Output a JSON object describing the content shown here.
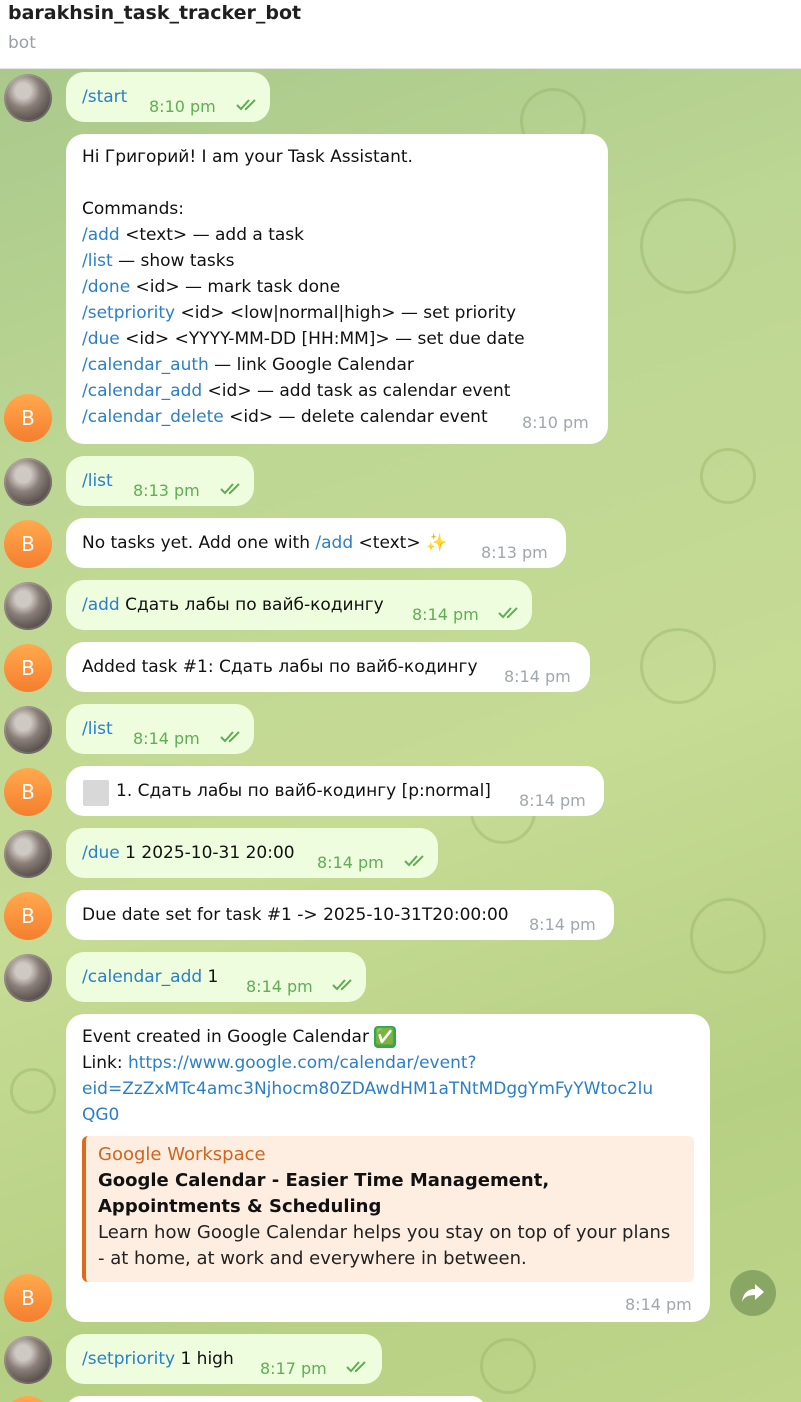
{
  "header": {
    "title": "barakhsin_task_tracker_bot",
    "subtitle": "bot"
  },
  "bot_avatar_letter": "B",
  "messages": [
    {
      "from": "user",
      "command": "/start",
      "text": "",
      "time": "8:10 pm"
    },
    {
      "from": "bot",
      "greeting": "Hi Григорий! I am your Task Assistant.",
      "commands_title": "Commands:",
      "commands": [
        {
          "cmd": "/add",
          "rest": " <text> — add a task"
        },
        {
          "cmd": "/list",
          "rest": " — show tasks"
        },
        {
          "cmd": "/done",
          "rest": " <id> — mark task done"
        },
        {
          "cmd": "/setpriority",
          "rest": " <id> <low|normal|high> — set priority"
        },
        {
          "cmd": "/due",
          "rest": " <id> <YYYY-MM-DD [HH:MM]> — set due date"
        },
        {
          "cmd": "/calendar_auth",
          "rest": " — link Google Calendar"
        },
        {
          "cmd": "/calendar_add",
          "rest": " <id> — add task as calendar event"
        },
        {
          "cmd": "/calendar_delete",
          "rest": " <id> — delete calendar event"
        }
      ],
      "time": "8:10 pm"
    },
    {
      "from": "user",
      "command": "/list",
      "text": "",
      "time": "8:13 pm"
    },
    {
      "from": "bot",
      "prefix": "No tasks yet. Add one with ",
      "cmd": "/add",
      "suffix": " <text> ",
      "emoji": "✨",
      "time": "8:13 pm"
    },
    {
      "from": "user",
      "command": "/add",
      "text": " Сдать лабы по вайб-кодингу",
      "time": "8:14 pm"
    },
    {
      "from": "bot",
      "text": "Added task #1: Сдать лабы по вайб-кодингу",
      "time": "8:14 pm"
    },
    {
      "from": "user",
      "command": "/list",
      "text": "",
      "time": "8:14 pm"
    },
    {
      "from": "bot",
      "text": "1. Сдать лабы по вайб-кодингу [p:normal]",
      "time": "8:14 pm"
    },
    {
      "from": "user",
      "command": "/due",
      "text": " 1 2025-10-31 20:00",
      "time": "8:14 pm"
    },
    {
      "from": "bot",
      "text": "Due date set for task #1 -> 2025-10-31T20:00:00",
      "time": "8:14 pm"
    },
    {
      "from": "user",
      "command": "/calendar_add",
      "text": " 1",
      "time": "8:14 pm"
    },
    {
      "from": "bot",
      "text": "Event created in Google Calendar ",
      "emoji": "✅",
      "link_label": "Link: ",
      "link_line1": "https://www.google.com/calendar/event?",
      "link_line2": "eid=ZzZxMTc4amc3Njhocm80ZDAwdHM1aTNtMDggYmFyYWtoc2lu",
      "link_line3": "QG0",
      "preview_site": "Google Workspace",
      "preview_title": "Google Calendar - Easier Time Management, Appointments & Scheduling",
      "preview_desc": "Learn how Google Calendar helps you stay on top of your plans - at home, at work and everywhere in between.",
      "time": "8:14 pm"
    },
    {
      "from": "user",
      "command": "/setpriority",
      "text": " 1 high",
      "time": "8:17 pm"
    }
  ],
  "colors": {
    "link": "#2a7fc7",
    "out_bubble": "#eefdde",
    "in_bubble": "#ffffff",
    "bot_avatar": "#f57e2e",
    "out_time": "#5fae53"
  }
}
